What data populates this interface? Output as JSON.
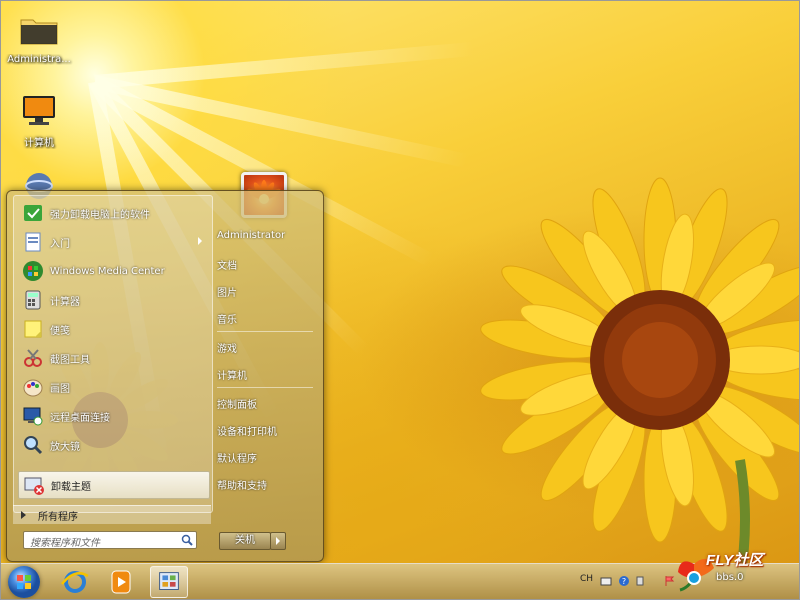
{
  "desktop": {
    "icons": [
      {
        "label": "Administra...",
        "icon": "folder-icon"
      },
      {
        "label": "计算机",
        "icon": "computer-icon"
      },
      {
        "label": "",
        "icon": "network-icon"
      }
    ]
  },
  "start_menu": {
    "programs": [
      {
        "label": "强力卸载电脑上的软件",
        "icon": "uninstall-icon",
        "has_submenu": false
      },
      {
        "label": "入门",
        "icon": "getting-started-icon",
        "has_submenu": true
      },
      {
        "label": "Windows Media Center",
        "icon": "media-center-icon",
        "has_submenu": false
      },
      {
        "label": "计算器",
        "icon": "calculator-icon",
        "has_submenu": false
      },
      {
        "label": "便笺",
        "icon": "sticky-notes-icon",
        "has_submenu": false
      },
      {
        "label": "截图工具",
        "icon": "snipping-tool-icon",
        "has_submenu": false
      },
      {
        "label": "画图",
        "icon": "paint-icon",
        "has_submenu": false
      },
      {
        "label": "远程桌面连接",
        "icon": "remote-desktop-icon",
        "has_submenu": false
      },
      {
        "label": "放大镜",
        "icon": "magnifier-icon",
        "has_submenu": false
      },
      {
        "label": "卸载主题",
        "icon": "uninstall-theme-icon",
        "has_submenu": false,
        "highlighted": true
      }
    ],
    "all_programs_label": "所有程序",
    "search_placeholder": "搜索程序和文件",
    "right_items_group1": [
      "Administrator",
      "文档",
      "图片",
      "音乐"
    ],
    "right_items_group2": [
      "游戏",
      "计算机"
    ],
    "right_items_group3": [
      "控制面板",
      "设备和打印机",
      "默认程序",
      "帮助和支持"
    ],
    "shutdown_label": "关机"
  },
  "taskbar": {
    "pinned": [
      {
        "icon": "start-orb-icon"
      },
      {
        "icon": "internet-explorer-icon"
      },
      {
        "icon": "media-player-icon"
      },
      {
        "icon": "control-panel-icon",
        "active": true
      }
    ],
    "tray": {
      "language": "CH"
    }
  },
  "watermark": {
    "brand": "FLY社区",
    "url": "bbs.0"
  },
  "colors": {
    "accent": "#f2c530",
    "start_menu_tint": "#b9a066"
  }
}
